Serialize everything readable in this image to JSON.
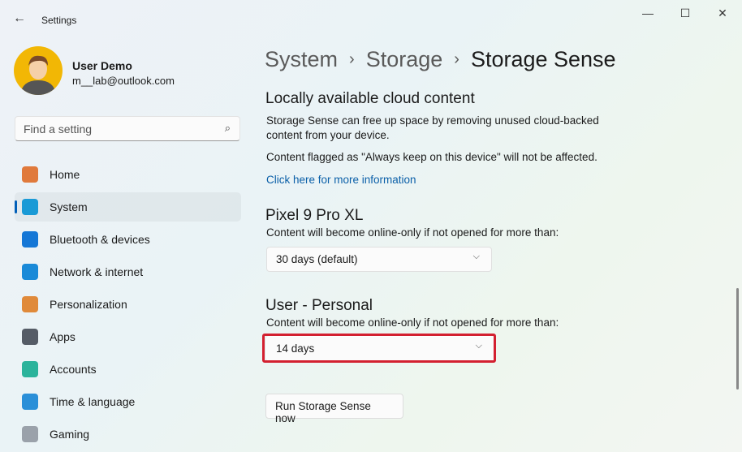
{
  "window": {
    "title": "Settings",
    "back": "←",
    "minimize": "—",
    "maximize": "☐",
    "close": "✕"
  },
  "user": {
    "name": "User Demo",
    "email": "m__lab@outlook.com"
  },
  "search": {
    "placeholder": "Find a setting",
    "icon": "⌕"
  },
  "nav": [
    {
      "label": "Home",
      "color": "#e07a3c"
    },
    {
      "label": "System",
      "color": "#1a9ad6",
      "selected": true
    },
    {
      "label": "Bluetooth & devices",
      "color": "#1577d6"
    },
    {
      "label": "Network & internet",
      "color": "#1a8ad8"
    },
    {
      "label": "Personalization",
      "color": "#e08a3a"
    },
    {
      "label": "Apps",
      "color": "#555c66"
    },
    {
      "label": "Accounts",
      "color": "#2bb39b"
    },
    {
      "label": "Time & language",
      "color": "#2a8fd8"
    },
    {
      "label": "Gaming",
      "color": "#9aa1aa"
    }
  ],
  "breadcrumb": {
    "items": [
      "System",
      "Storage",
      "Storage Sense"
    ],
    "sep": "›"
  },
  "cloud": {
    "heading": "Locally available cloud content",
    "desc": "Storage Sense can free up space by removing unused cloud-backed content from your device.",
    "note": "Content flagged as \"Always keep on this device\" will not be affected.",
    "link": "Click here for more information"
  },
  "pixel": {
    "heading": "Pixel 9 Pro XL",
    "desc": "Content will become online-only if not opened for more than:",
    "value": "30 days (default)"
  },
  "personal": {
    "heading": "User - Personal",
    "desc": "Content will become online-only if not opened for more than:",
    "value": "14 days"
  },
  "chevron": "⌵",
  "run_button": "Run Storage Sense now"
}
